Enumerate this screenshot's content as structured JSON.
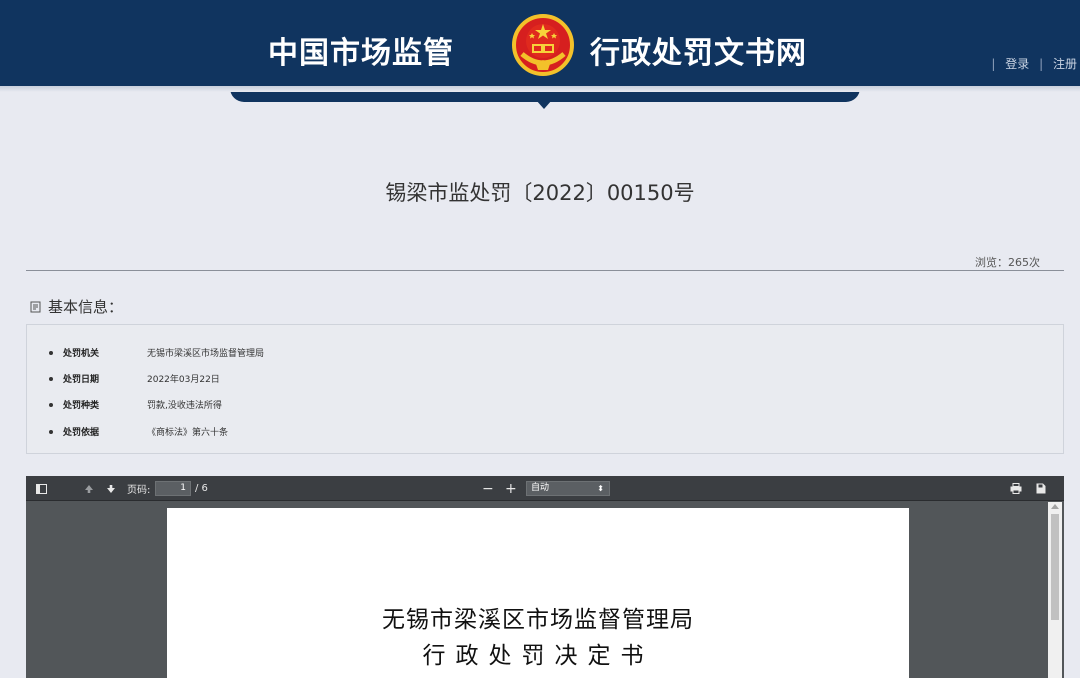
{
  "header": {
    "title_left": "中国市场监管",
    "title_right": "行政处罚文书网",
    "login_label": "登录",
    "register_label": "注册",
    "separator": "|"
  },
  "document": {
    "title": "锡梁市监处罚〔2022〕00150号",
    "views": "浏览：265次"
  },
  "basic_info": {
    "heading": "基本信息：",
    "items": [
      {
        "label": "处罚机关",
        "value": "无锡市梁溪区市场监督管理局"
      },
      {
        "label": "处罚日期",
        "value": "2022年03月22日"
      },
      {
        "label": "处罚种类",
        "value": "罚款,没收违法所得"
      },
      {
        "label": "处罚依据",
        "value": "《商标法》第六十条"
      }
    ]
  },
  "viewer": {
    "page_label": "页码:",
    "page_current": "1",
    "page_total": "/ 6",
    "zoom_value": "自动",
    "zoom_out": "−",
    "zoom_in": "+",
    "page_text_line1": "无锡市梁溪区市场监督管理局",
    "page_text_line2": "行政处罚决定书"
  },
  "colors": {
    "header_bg": "#10345f",
    "page_bg": "#e8eaf1",
    "viewer_bg": "#525659",
    "toolbar_bg": "#3b3e42"
  }
}
